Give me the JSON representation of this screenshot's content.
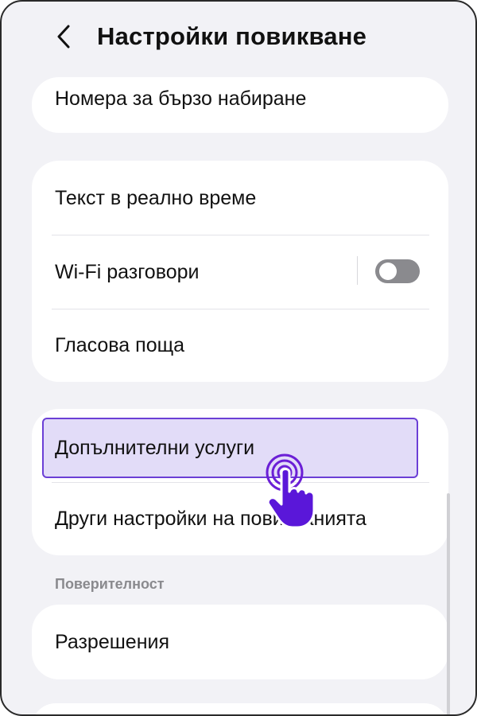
{
  "header": {
    "title": "Настройки повикване",
    "back_icon": "chevron-left-icon"
  },
  "items": {
    "speed_dial": "Номера за бързо набиране",
    "rtt": "Текст в реално време",
    "wifi_calling": "Wi-Fi разговори",
    "voicemail": "Гласова поща",
    "supplementary": "Допълнителни услуги",
    "other_settings": "Други настройки на повикванията",
    "permissions": "Разрешения"
  },
  "wifi_calling_toggle": {
    "state": "off"
  },
  "sections": {
    "privacy": "Поверителност"
  },
  "colors": {
    "accent": "#6b3fd6",
    "highlight_fill": "#e2dcf8",
    "background": "#f2f2f6",
    "toggle_off": "#8a8a8e"
  },
  "pointer": {
    "icon": "tap-hand-icon"
  }
}
